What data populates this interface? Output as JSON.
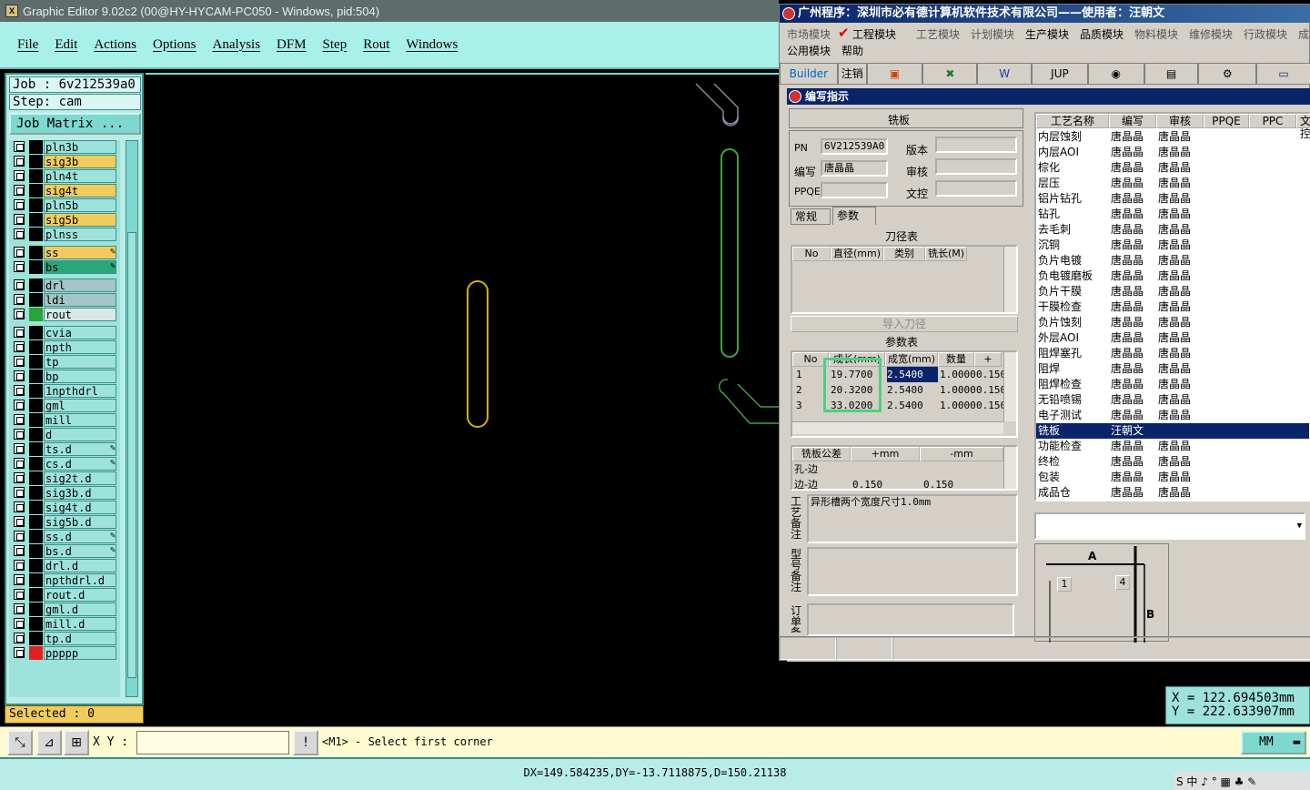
{
  "editor": {
    "title": "Graphic Editor 9.02c2 (00@HY-HYCAM-PC050 - Windows, pid:504)",
    "menu": [
      "File",
      "Edit",
      "Actions",
      "Options",
      "Analysis",
      "DFM",
      "Step",
      "Rout",
      "Windows"
    ],
    "job": "Job : 6v212539a0",
    "step": "Step: cam",
    "job_matrix": "Job Matrix ...",
    "layers": [
      {
        "name": "pln3b",
        "color": "#9ee3db",
        "swatch": "#000"
      },
      {
        "name": "sig3b",
        "color": "#f1cc5c",
        "swatch": "#000"
      },
      {
        "name": "pln4t",
        "color": "#9ee3db",
        "swatch": "#000"
      },
      {
        "name": "sig4t",
        "color": "#f1cc5c",
        "swatch": "#000"
      },
      {
        "name": "pln5b",
        "color": "#9ee3db",
        "swatch": "#000"
      },
      {
        "name": "sig5b",
        "color": "#f1cc5c",
        "swatch": "#000"
      },
      {
        "name": "plnss",
        "color": "#9ee3db",
        "swatch": "#000"
      },
      {
        "name": "ss",
        "color": "#f1cc5c",
        "swatch": "#000",
        "mark": true
      },
      {
        "name": "bs",
        "color": "#2aa77a",
        "swatch": "#000",
        "mark": true
      },
      {
        "name": "drl",
        "color": "#a4c4c8",
        "swatch": "#000"
      },
      {
        "name": "ldi",
        "color": "#a4c4c8",
        "swatch": "#000"
      },
      {
        "name": "rout",
        "color": "#d8e8e6",
        "swatch": "#2aa33a"
      },
      {
        "name": "cvia",
        "color": "#9ee3db",
        "swatch": "#000"
      },
      {
        "name": "npth",
        "color": "#9ee3db",
        "swatch": "#000"
      },
      {
        "name": "tp",
        "color": "#9ee3db",
        "swatch": "#000"
      },
      {
        "name": "bp",
        "color": "#9ee3db",
        "swatch": "#000"
      },
      {
        "name": "1npthdrl",
        "color": "#9ee3db",
        "swatch": "#000"
      },
      {
        "name": "gml",
        "color": "#9ee3db",
        "swatch": "#000"
      },
      {
        "name": "mill",
        "color": "#9ee3db",
        "swatch": "#000"
      },
      {
        "name": "d",
        "color": "#9ee3db",
        "swatch": "#000"
      },
      {
        "name": "ts.d",
        "color": "#9ee3db",
        "swatch": "#000",
        "mark": true
      },
      {
        "name": "cs.d",
        "color": "#9ee3db",
        "swatch": "#000",
        "mark": true
      },
      {
        "name": "sig2t.d",
        "color": "#9ee3db",
        "swatch": "#000"
      },
      {
        "name": "sig3b.d",
        "color": "#9ee3db",
        "swatch": "#000"
      },
      {
        "name": "sig4t.d",
        "color": "#9ee3db",
        "swatch": "#000"
      },
      {
        "name": "sig5b.d",
        "color": "#9ee3db",
        "swatch": "#000"
      },
      {
        "name": "ss.d",
        "color": "#9ee3db",
        "swatch": "#000",
        "mark": true
      },
      {
        "name": "bs.d",
        "color": "#9ee3db",
        "swatch": "#000",
        "mark": true
      },
      {
        "name": "drl.d",
        "color": "#9ee3db",
        "swatch": "#000"
      },
      {
        "name": "npthdrl.d",
        "color": "#9ee3db",
        "swatch": "#000"
      },
      {
        "name": "rout.d",
        "color": "#9ee3db",
        "swatch": "#000"
      },
      {
        "name": "gml.d",
        "color": "#9ee3db",
        "swatch": "#000"
      },
      {
        "name": "mill.d",
        "color": "#9ee3db",
        "swatch": "#000"
      },
      {
        "name": "tp.d",
        "color": "#9ee3db",
        "swatch": "#000"
      },
      {
        "name": "ppppp",
        "color": "#9ee3db",
        "swatch": "#e02020"
      }
    ],
    "selected": "Selected : 0",
    "xy_label": "X Y :",
    "prompt": "<M1> - Select first corner",
    "unit": "MM",
    "status": "DX=149.584235,DY=-13.7118875,D=150.21138",
    "coord_x": "X = 122.694503mm",
    "coord_y": "Y = 222.633907mm"
  },
  "erp": {
    "title": "广州程序：深圳市必有德计算机软件技术有限公司——使用者：汪朝文",
    "menu": [
      "市场模块",
      "工程模块",
      "工艺模块",
      "计划模块",
      "生产模块",
      "品质模块",
      "物料模块",
      "维修模块",
      "行政模块",
      "成",
      "公用模块",
      "帮助"
    ],
    "toolbar": [
      "Builder",
      "注销",
      "",
      "",
      "",
      "JUP",
      "",
      "",
      "",
      ""
    ],
    "dialog": {
      "title": "编写指示",
      "header": "铣板",
      "pn_label": "PN",
      "pn_value": "6V212539A0",
      "version_label": "版本",
      "writer_label": "编写",
      "writer_value": "唐晶晶",
      "audit_label": "审核",
      "ppqe_label": "PPQE",
      "doc_label": "文控",
      "tabs": [
        "常规",
        "参数"
      ],
      "tool_table_title": "刀径表",
      "tool_cols": [
        "No",
        "直径(mm)",
        "类别",
        "铣长(M)"
      ],
      "import_btn": "导入刀径",
      "param_title": "参数表",
      "param_cols": [
        "No",
        "成长(mm)",
        "成宽(mm)",
        "数量",
        "+"
      ],
      "param_rows": [
        [
          "1",
          "19.7700",
          "2.5400",
          "1.0000",
          "0.150"
        ],
        [
          "2",
          "20.3200",
          "2.5400",
          "1.0000",
          "0.150"
        ],
        [
          "3",
          "33.0200",
          "2.5400",
          "1.0000",
          "0.150"
        ]
      ],
      "tol_cols": [
        "铣板公差",
        "+mm",
        "-mm"
      ],
      "tol_rows": [
        [
          "孔-边",
          "",
          ""
        ],
        [
          "边-边",
          "0.150",
          "0.150"
        ]
      ],
      "note1_label": "工艺备注",
      "note1_value": "异形槽两个宽度尺寸1.0mm",
      "note2_label": "型号备注",
      "note3_label": "订单备"
    },
    "process_cols": [
      "工艺名称",
      "编写",
      "审核",
      "PPQE",
      "PPC",
      "文控"
    ],
    "processes": [
      [
        "内层蚀刻",
        "唐晶晶",
        "唐晶晶"
      ],
      [
        "内层AOI",
        "唐晶晶",
        "唐晶晶"
      ],
      [
        "棕化",
        "唐晶晶",
        "唐晶晶"
      ],
      [
        "层压",
        "唐晶晶",
        "唐晶晶"
      ],
      [
        "铝片钻孔",
        "唐晶晶",
        "唐晶晶"
      ],
      [
        "钻孔",
        "唐晶晶",
        "唐晶晶"
      ],
      [
        "去毛刺",
        "唐晶晶",
        "唐晶晶"
      ],
      [
        "沉铜",
        "唐晶晶",
        "唐晶晶"
      ],
      [
        "负片电镀",
        "唐晶晶",
        "唐晶晶"
      ],
      [
        "负电镀磨板",
        "唐晶晶",
        "唐晶晶"
      ],
      [
        "负片干膜",
        "唐晶晶",
        "唐晶晶"
      ],
      [
        "干膜检查",
        "唐晶晶",
        "唐晶晶"
      ],
      [
        "负片蚀刻",
        "唐晶晶",
        "唐晶晶"
      ],
      [
        "外层AOI",
        "唐晶晶",
        "唐晶晶"
      ],
      [
        "阻焊塞孔",
        "唐晶晶",
        "唐晶晶"
      ],
      [
        "阻焊",
        "唐晶晶",
        "唐晶晶"
      ],
      [
        "阻焊检查",
        "唐晶晶",
        "唐晶晶"
      ],
      [
        "无铅喷锡",
        "唐晶晶",
        "唐晶晶"
      ],
      [
        "电子测试",
        "唐晶晶",
        "唐晶晶"
      ],
      [
        "铣板",
        "汪朝文",
        ""
      ],
      [
        "功能检查",
        "唐晶晶",
        "唐晶晶"
      ],
      [
        "终检",
        "唐晶晶",
        "唐晶晶"
      ],
      [
        "包装",
        "唐晶晶",
        "唐晶晶"
      ],
      [
        "成品仓",
        "唐晶晶",
        "唐晶晶"
      ]
    ],
    "diagram": {
      "a": "A",
      "b": "B",
      "n1": "1",
      "n4": "4"
    }
  },
  "tray": "S 中 ♪ ° ▦ ♣ ✎"
}
